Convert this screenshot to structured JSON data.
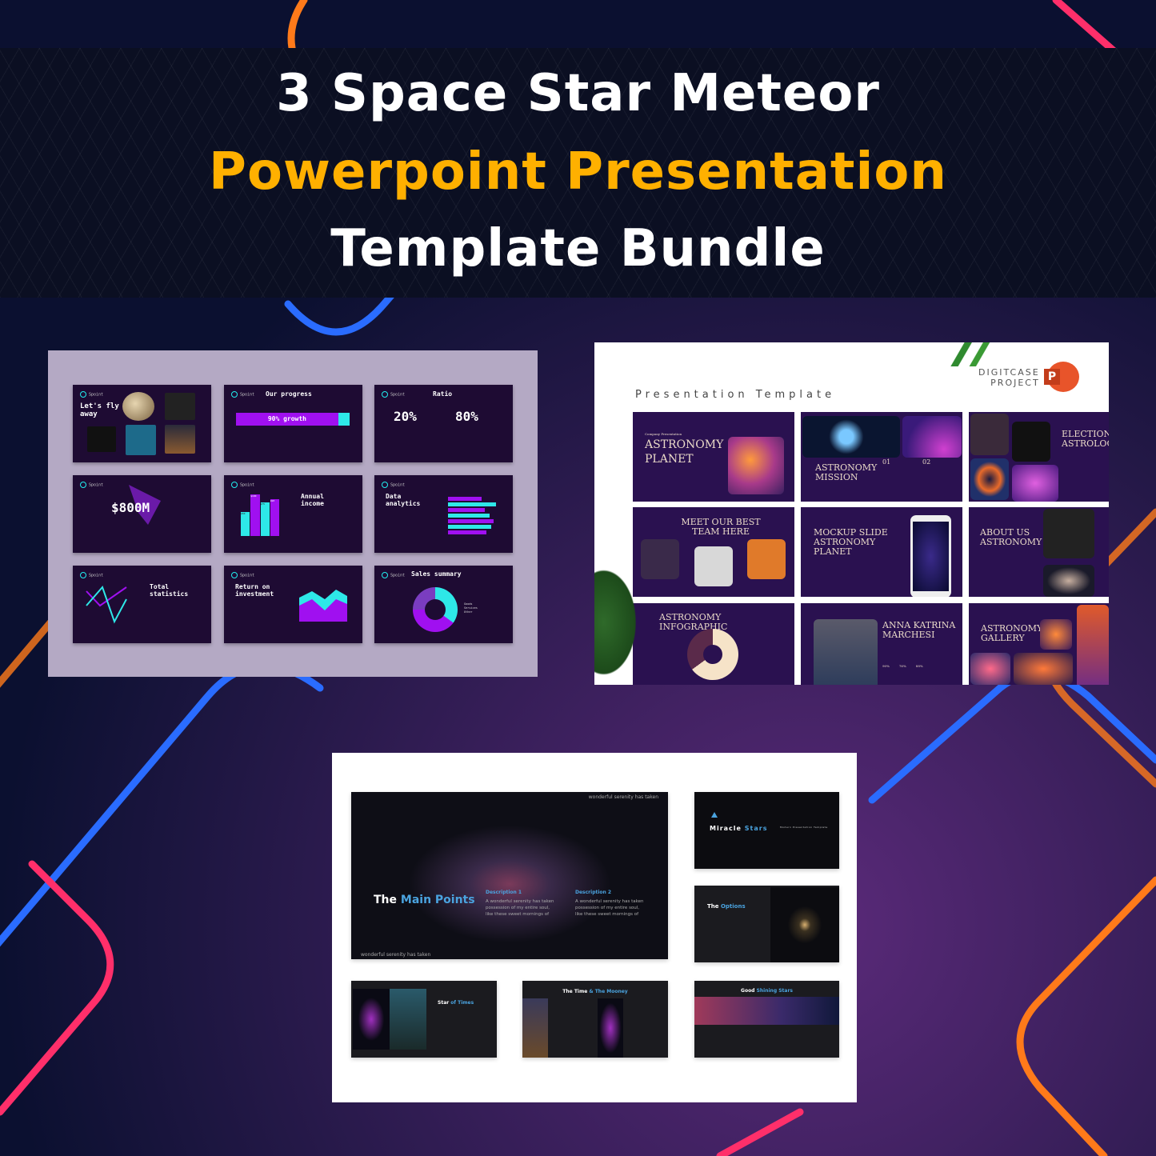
{
  "title": {
    "line1": "3 Space Star Meteor",
    "line2": "Powerpoint Presentation",
    "line3": "Template Bundle",
    "accent": "#FFB000"
  },
  "panel1": {
    "brand": "Spoint",
    "slides": [
      {
        "title": "Let's fly away"
      },
      {
        "title": "Our progress",
        "bar": "90% growth",
        "progress": 90
      },
      {
        "title": "Ratio",
        "left": "20%",
        "right": "80%"
      },
      {
        "title": "$800M"
      },
      {
        "title": "Annual income",
        "bars": [
          "$50",
          "$100",
          "$75",
          "$90"
        ]
      },
      {
        "title": "Data analytics"
      },
      {
        "title": "Total statistics"
      },
      {
        "title": "Return on investment"
      },
      {
        "title": "Sales summary",
        "slices": [
          "25%",
          "35%",
          "40%"
        ],
        "legend": [
          "Goods",
          "Services",
          "Other"
        ]
      }
    ]
  },
  "panel2": {
    "heading": "Presentation Template",
    "brand_line1": "DIGITCASE",
    "brand_line2": "PROJECT",
    "ppt_icon": "P",
    "slides": [
      {
        "kicker": "Company Presentation",
        "title": "Astronomy Planet"
      },
      {
        "title": "Astronomy Mission",
        "n1": "01",
        "n2": "02"
      },
      {
        "title": "Electional Astrology"
      },
      {
        "title": "Meet our best team here"
      },
      {
        "title": "Mockup slide Astronomy Planet"
      },
      {
        "title": "About us Astronomy"
      },
      {
        "title": "Astronomy Infographic"
      },
      {
        "title": "Anna Katrina Marchesi",
        "stats": [
          "90%",
          "76%",
          "88%"
        ]
      },
      {
        "title": "Astronomy Gallery"
      }
    ]
  },
  "panel3": {
    "main": {
      "title_a": "The",
      "title_b": "Main Points",
      "caption": "wonderful serenity has taken",
      "d1": "Description 1",
      "d2": "Description 2",
      "body": "A wonderful serenity has taken possession of my entire soul, like these sweet mornings of"
    },
    "miracle": {
      "a": "Miracle",
      "b": "Stars",
      "sub": "Modern Presentation Template"
    },
    "options": {
      "a": "The",
      "b": "Options"
    },
    "star": {
      "a": "Star",
      "b": "of Times"
    },
    "time": {
      "a": "The Time",
      "b": "& The Mooney"
    },
    "good": {
      "a": "Good",
      "b": "Shining Stars"
    }
  }
}
